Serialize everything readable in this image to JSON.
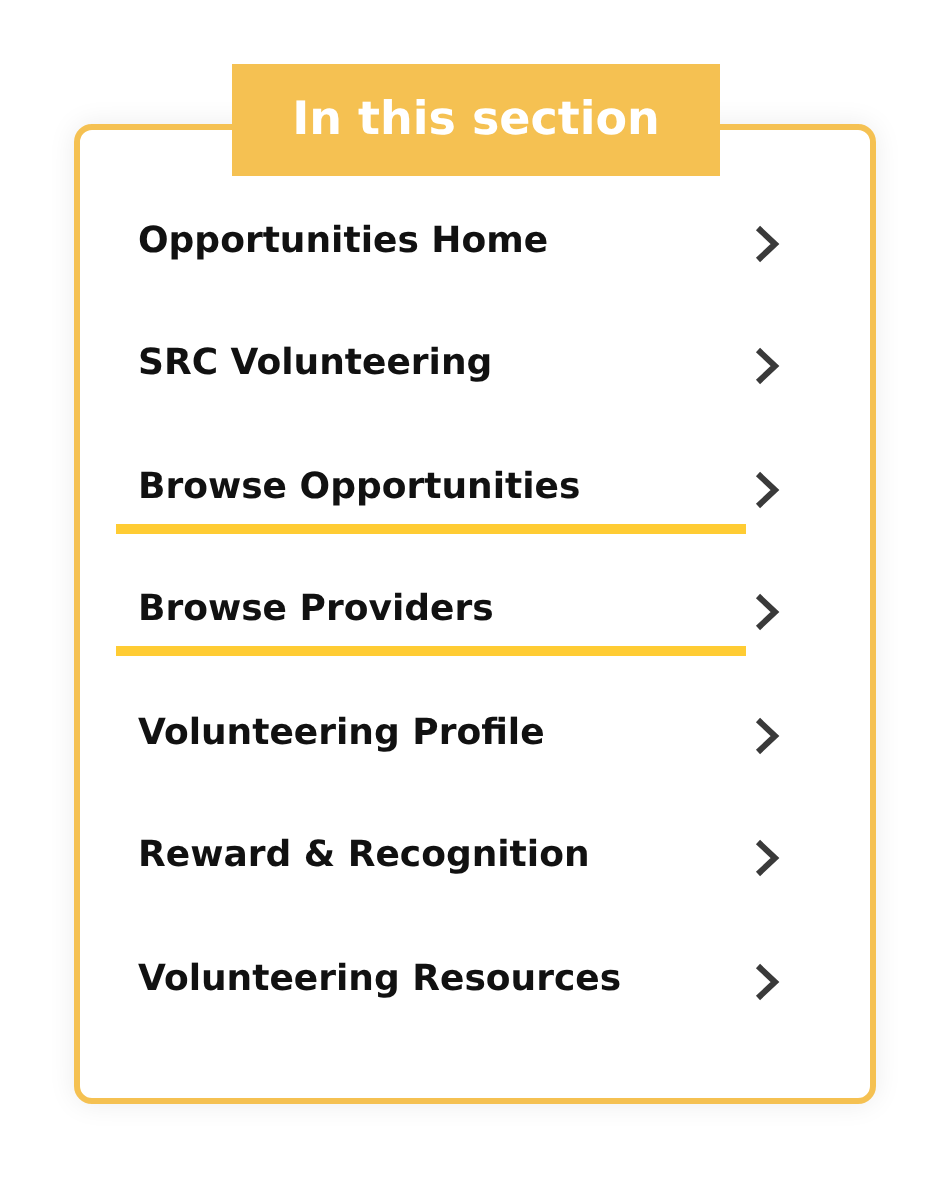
{
  "section_heading": "In this section",
  "nav_items": [
    {
      "label": "Opportunities Home",
      "selected": false
    },
    {
      "label": "SRC Volunteering",
      "selected": false
    },
    {
      "label": "Browse Opportunities",
      "selected": true
    },
    {
      "label": "Browse Providers",
      "selected": true
    },
    {
      "label": "Volunteering Profile",
      "selected": false
    },
    {
      "label": "Reward & Recognition",
      "selected": false
    },
    {
      "label": "Volunteering Resources",
      "selected": false
    }
  ]
}
